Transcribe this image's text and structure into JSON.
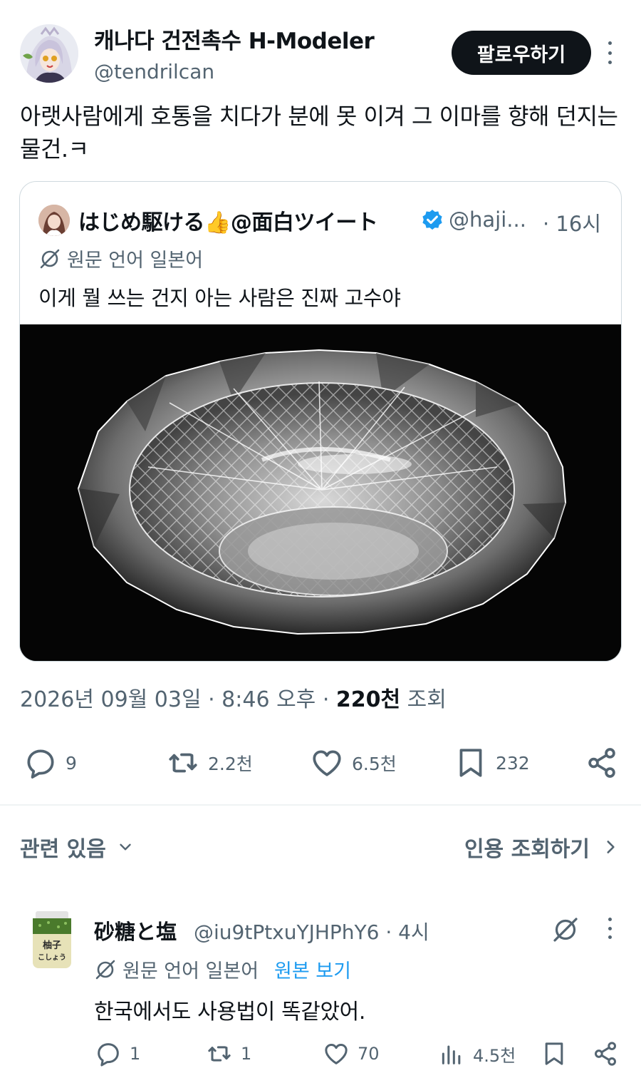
{
  "author": {
    "display_name": "캐나다 건전촉수 H-Modeler",
    "handle": "@tendrilcan",
    "follow_label": "팔로우하기"
  },
  "tweet": {
    "text": "아랫사람에게 호통을 치다가 분에 못 이겨 그 이마를 향해 던지는 물건.ㅋ",
    "date": "2026년 09월 03일 · 8:46 오후 · ",
    "views_count": "220천",
    "views_label": " 조회"
  },
  "quote": {
    "name": "はじめ駆ける👍@面白ツイート",
    "handle": "@haji...",
    "time": "· 16시",
    "translate_label": "원문 언어 일본어",
    "text": "이게 뭘 쓰는 건지 아는 사람은 진짜 고수야"
  },
  "actions": {
    "replies": "9",
    "reposts": "2.2천",
    "likes": "6.5천",
    "bookmarks": "232"
  },
  "related": {
    "label": "관련 있음",
    "quotes_label": "인용 조회하기"
  },
  "reply": {
    "name": "砂糖と塩",
    "handle_time": "@iu9tPtxuYJHPhY6 · 4시",
    "translate_label": "원문 언어 일본어",
    "show_original": "원본 보기",
    "text": "한국에서도 사용법이 똑같았어.",
    "replies": "1",
    "reposts": "1",
    "likes": "70",
    "views": "4.5천",
    "avatar_text_1": "柚子",
    "avatar_text_2": "こしょう"
  },
  "colors": {
    "text": "#0f1419",
    "muted": "#536471",
    "accent": "#1d9bf0",
    "border": "#cfd9de"
  }
}
